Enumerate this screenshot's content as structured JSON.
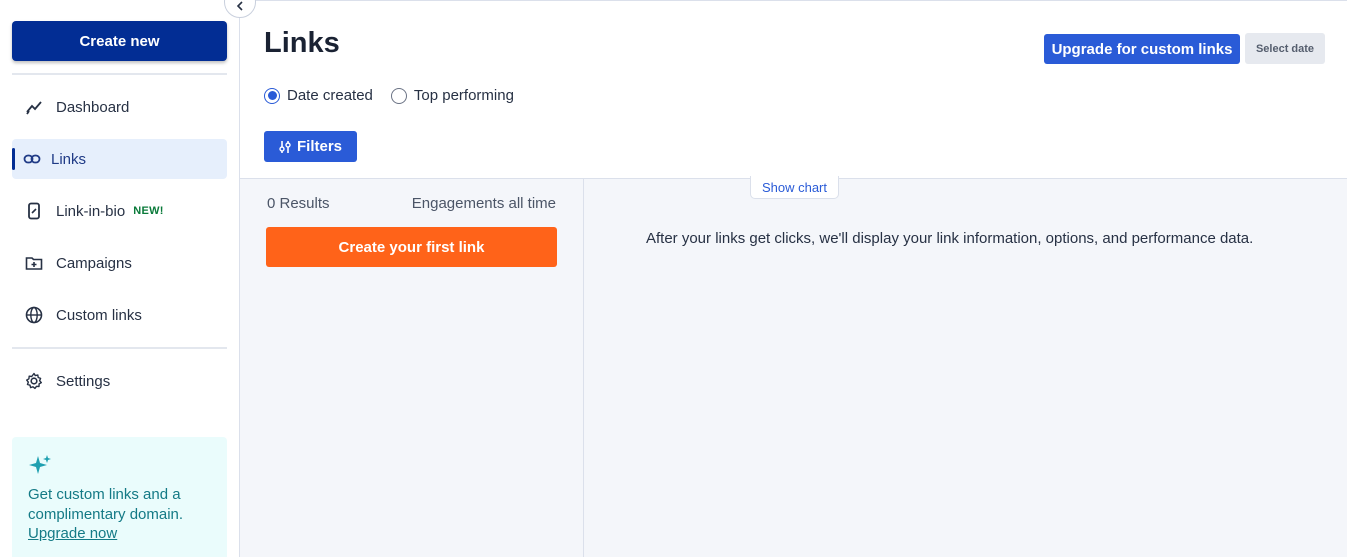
{
  "sidebar": {
    "create_new_label": "Create new",
    "items": [
      {
        "label": "Dashboard",
        "icon": "chart-line-icon"
      },
      {
        "label": "Links",
        "icon": "link-icon",
        "active": true
      },
      {
        "label": "Link-in-bio",
        "icon": "phone-link-icon",
        "badge": "NEW!"
      },
      {
        "label": "Campaigns",
        "icon": "folder-plus-icon"
      },
      {
        "label": "Custom links",
        "icon": "globe-icon"
      },
      {
        "label": "Settings",
        "icon": "gear-icon"
      }
    ],
    "promo": {
      "text": "Get custom links and a complimentary domain.",
      "link_label": "Upgrade now"
    }
  },
  "header": {
    "title": "Links",
    "upgrade_label": "Upgrade for custom links",
    "date_label": "Select date",
    "sort_options": [
      {
        "label": "Date created",
        "checked": true
      },
      {
        "label": "Top performing",
        "checked": false
      }
    ],
    "filters_label": "Filters"
  },
  "list": {
    "results_label": "0 Results",
    "engagements_label": "Engagements all time",
    "create_first_label": "Create your first link"
  },
  "detail": {
    "show_chart_label": "Show chart",
    "empty_message": "After your links get clicks, we'll display your link information, options, and performance data."
  },
  "colors": {
    "primary_dark": "#022d94",
    "primary": "#2a5bd7",
    "accent_orange": "#ff6319",
    "promo_bg": "#eafcfc",
    "promo_text": "#147a86"
  }
}
